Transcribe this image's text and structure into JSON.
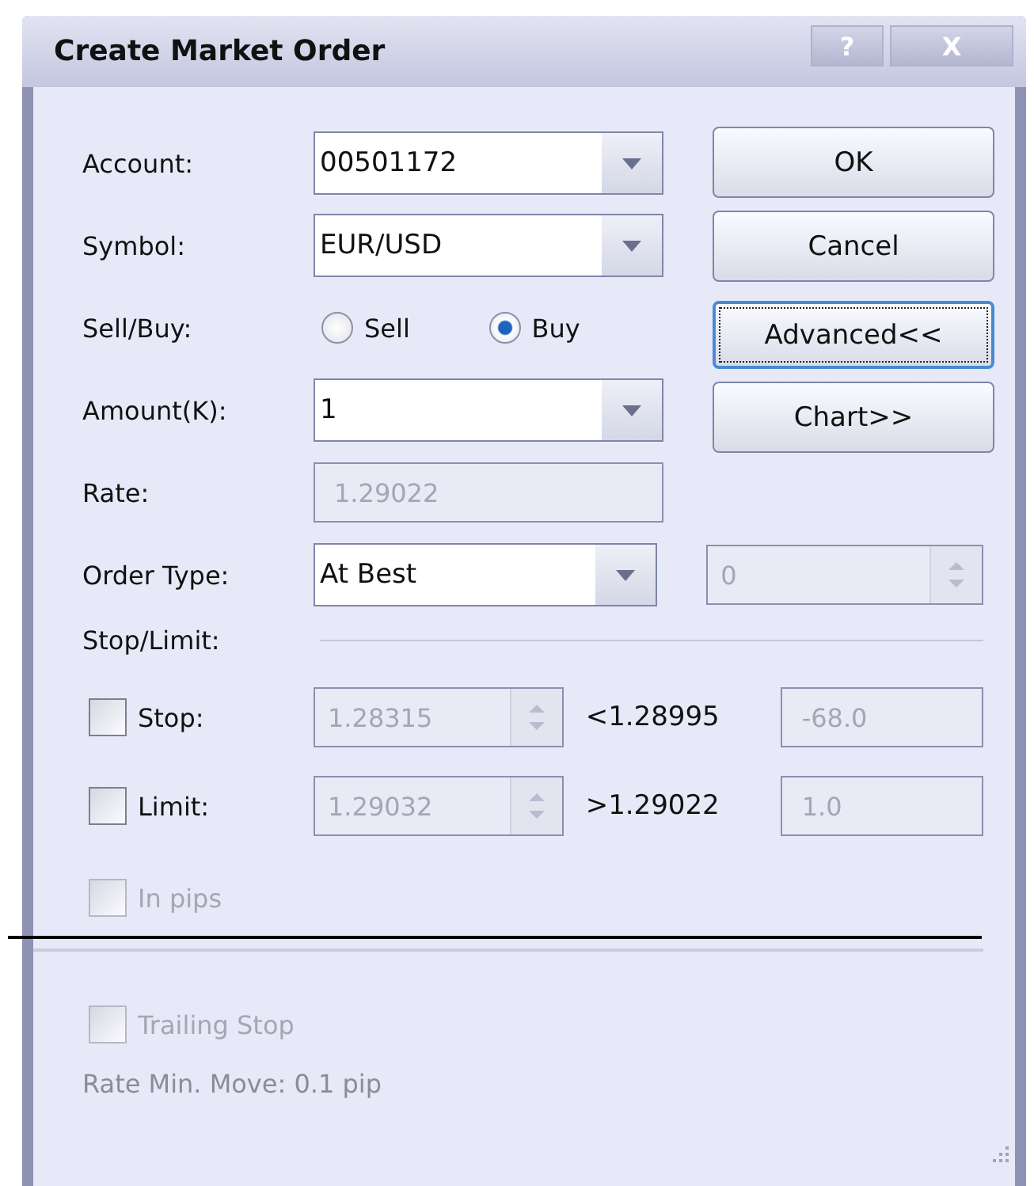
{
  "window": {
    "title": "Create Market Order",
    "help_button": "?",
    "close_button": "X"
  },
  "account": {
    "label": "Account:",
    "value": "00501172"
  },
  "symbol": {
    "label": "Symbol:",
    "value": "EUR/USD"
  },
  "side": {
    "label": "Sell/Buy:",
    "options": [
      {
        "label": "Sell",
        "selected": false
      },
      {
        "label": "Buy",
        "selected": true
      }
    ]
  },
  "amount": {
    "label": "Amount(K):",
    "value": "1"
  },
  "rate": {
    "label": "Rate:",
    "value": "1.29022",
    "disabled": true
  },
  "buttons": [
    {
      "label": "OK",
      "focused": false
    },
    {
      "label": "Cancel",
      "focused": false
    },
    {
      "label": "Advanced<<",
      "focused": true
    },
    {
      "label": "Chart>>",
      "focused": false
    }
  ],
  "order_type": {
    "label": "Order Type:",
    "value": "At Best",
    "price": "0",
    "price_disabled": true
  },
  "stop_limit": {
    "label": "Stop/Limit:",
    "rows": [
      {
        "label": "Stop:",
        "checked": false,
        "rate": "1.28315",
        "bound": "<1.28995",
        "pips": "-68.0"
      },
      {
        "label": "Limit:",
        "checked": false,
        "rate": "1.29032",
        "bound": ">1.29022",
        "pips": "1.0"
      }
    ]
  },
  "in_pips": {
    "label": "In pips",
    "checked": false,
    "disabled": true
  },
  "trailing_stop": {
    "label": "Trailing Stop",
    "checked": false,
    "disabled": true
  },
  "min_move": "Rate Min. Move: 0.1 pip"
}
